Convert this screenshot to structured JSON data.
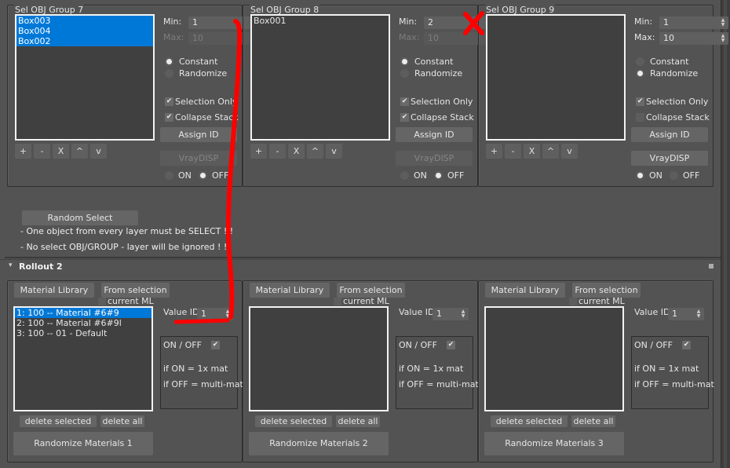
{
  "rollout1": {
    "groups": [
      {
        "title": "Sel OBJ Group 7",
        "items": [
          "Box003",
          "Box004",
          "Box002"
        ],
        "selected_items": [
          0,
          1,
          2
        ],
        "min_label": "Min:",
        "min_value": "1",
        "max_label": "Max:",
        "max_value": "10",
        "max_enabled": false,
        "constant_label": "Constant",
        "randomize_label": "Randomize",
        "mode": "Constant",
        "selection_only_label": "Selection Only",
        "selection_only": true,
        "collapse_stack_label": "Collapse Stack",
        "collapse_stack": true,
        "assign_id_label": "Assign ID",
        "vraydisp_label": "VrayDISP",
        "vraydisp_enabled": false,
        "on_label": "ON",
        "off_label": "OFF",
        "vraydisp_state": "OFF",
        "list_buttons": [
          "+",
          "-",
          "X",
          "^",
          "v"
        ]
      },
      {
        "title": "Sel OBJ Group 8",
        "items": [
          "Box001"
        ],
        "selected_items": [],
        "min_label": "Min:",
        "min_value": "2",
        "max_label": "Max:",
        "max_value": "10",
        "max_enabled": false,
        "constant_label": "Constant",
        "randomize_label": "Randomize",
        "mode": "Constant",
        "selection_only_label": "Selection Only",
        "selection_only": true,
        "collapse_stack_label": "Collapse Stack",
        "collapse_stack": true,
        "assign_id_label": "Assign ID",
        "vraydisp_label": "VrayDISP",
        "vraydisp_enabled": false,
        "on_label": "ON",
        "off_label": "OFF",
        "vraydisp_state": "OFF",
        "list_buttons": [
          "+",
          "-",
          "X",
          "^",
          "v"
        ]
      },
      {
        "title": "Sel OBJ Group 9",
        "items": [],
        "selected_items": [],
        "min_label": "Min:",
        "min_value": "1",
        "max_label": "Max:",
        "max_value": "10",
        "max_enabled": true,
        "constant_label": "Constant",
        "randomize_label": "Randomize",
        "mode": "Randomize",
        "selection_only_label": "Selection Only",
        "selection_only": true,
        "collapse_stack_label": "Collapse Stack",
        "collapse_stack": false,
        "assign_id_label": "Assign ID",
        "vraydisp_label": "VrayDISP",
        "vraydisp_enabled": true,
        "on_label": "ON",
        "off_label": "OFF",
        "vraydisp_state": "ON",
        "list_buttons": [
          "+",
          "-",
          "X",
          "^",
          "v"
        ]
      }
    ],
    "random_select_label": "Random Select",
    "notes": [
      "- One object from every layer must be SELECT ! !",
      "- No select OBJ/GROUP  - layer will be ignored ! !"
    ]
  },
  "rollout2": {
    "title": "Rollout 2",
    "collapse_glyph": "▾",
    "panels": [
      {
        "material_library_label": "Material Library",
        "from_selection_label": "From selection",
        "current_ml_label": "current ML",
        "current_ml_checked": false,
        "items": [
          "1: 100 -- Material #6#9",
          "2: 100 -- Material #6#9l",
          "3: 100 -- 01 - Default"
        ],
        "selected_index": 0,
        "value_id_label": "Value ID",
        "value_id": "1",
        "on_off_label": "ON / OFF",
        "on_off_checked": true,
        "if_on_text": "if ON = 1x mat",
        "if_off_text": "if OFF = multi-mat",
        "delete_selected_label": "delete selected",
        "delete_all_label": "delete all",
        "randomize_label": "Randomize Materials 1"
      },
      {
        "material_library_label": "Material Library",
        "from_selection_label": "From selection",
        "current_ml_label": "current ML",
        "current_ml_checked": false,
        "items": [],
        "selected_index": -1,
        "value_id_label": "Value ID",
        "value_id": "1",
        "on_off_label": "ON / OFF",
        "on_off_checked": true,
        "if_on_text": "if ON = 1x mat",
        "if_off_text": "if OFF = multi-mat",
        "delete_selected_label": "delete selected",
        "delete_all_label": "delete all",
        "randomize_label": "Randomize Materials 2"
      },
      {
        "material_library_label": "Material Library",
        "from_selection_label": "From selection",
        "current_ml_label": "current ML",
        "current_ml_checked": false,
        "items": [],
        "selected_index": -1,
        "value_id_label": "Value ID",
        "value_id": "1",
        "on_off_label": "ON / OFF",
        "on_off_checked": true,
        "if_on_text": "if ON = 1x mat",
        "if_off_text": "if OFF = multi-mat",
        "delete_selected_label": "delete selected",
        "delete_all_label": "delete all",
        "randomize_label": "Randomize Materials 3"
      }
    ]
  },
  "icons": {
    "check": "✔",
    "spinner_up": "▲",
    "spinner_down": "▼"
  },
  "annotation_color": "#ff0000",
  "selection_color": "#0078d7"
}
